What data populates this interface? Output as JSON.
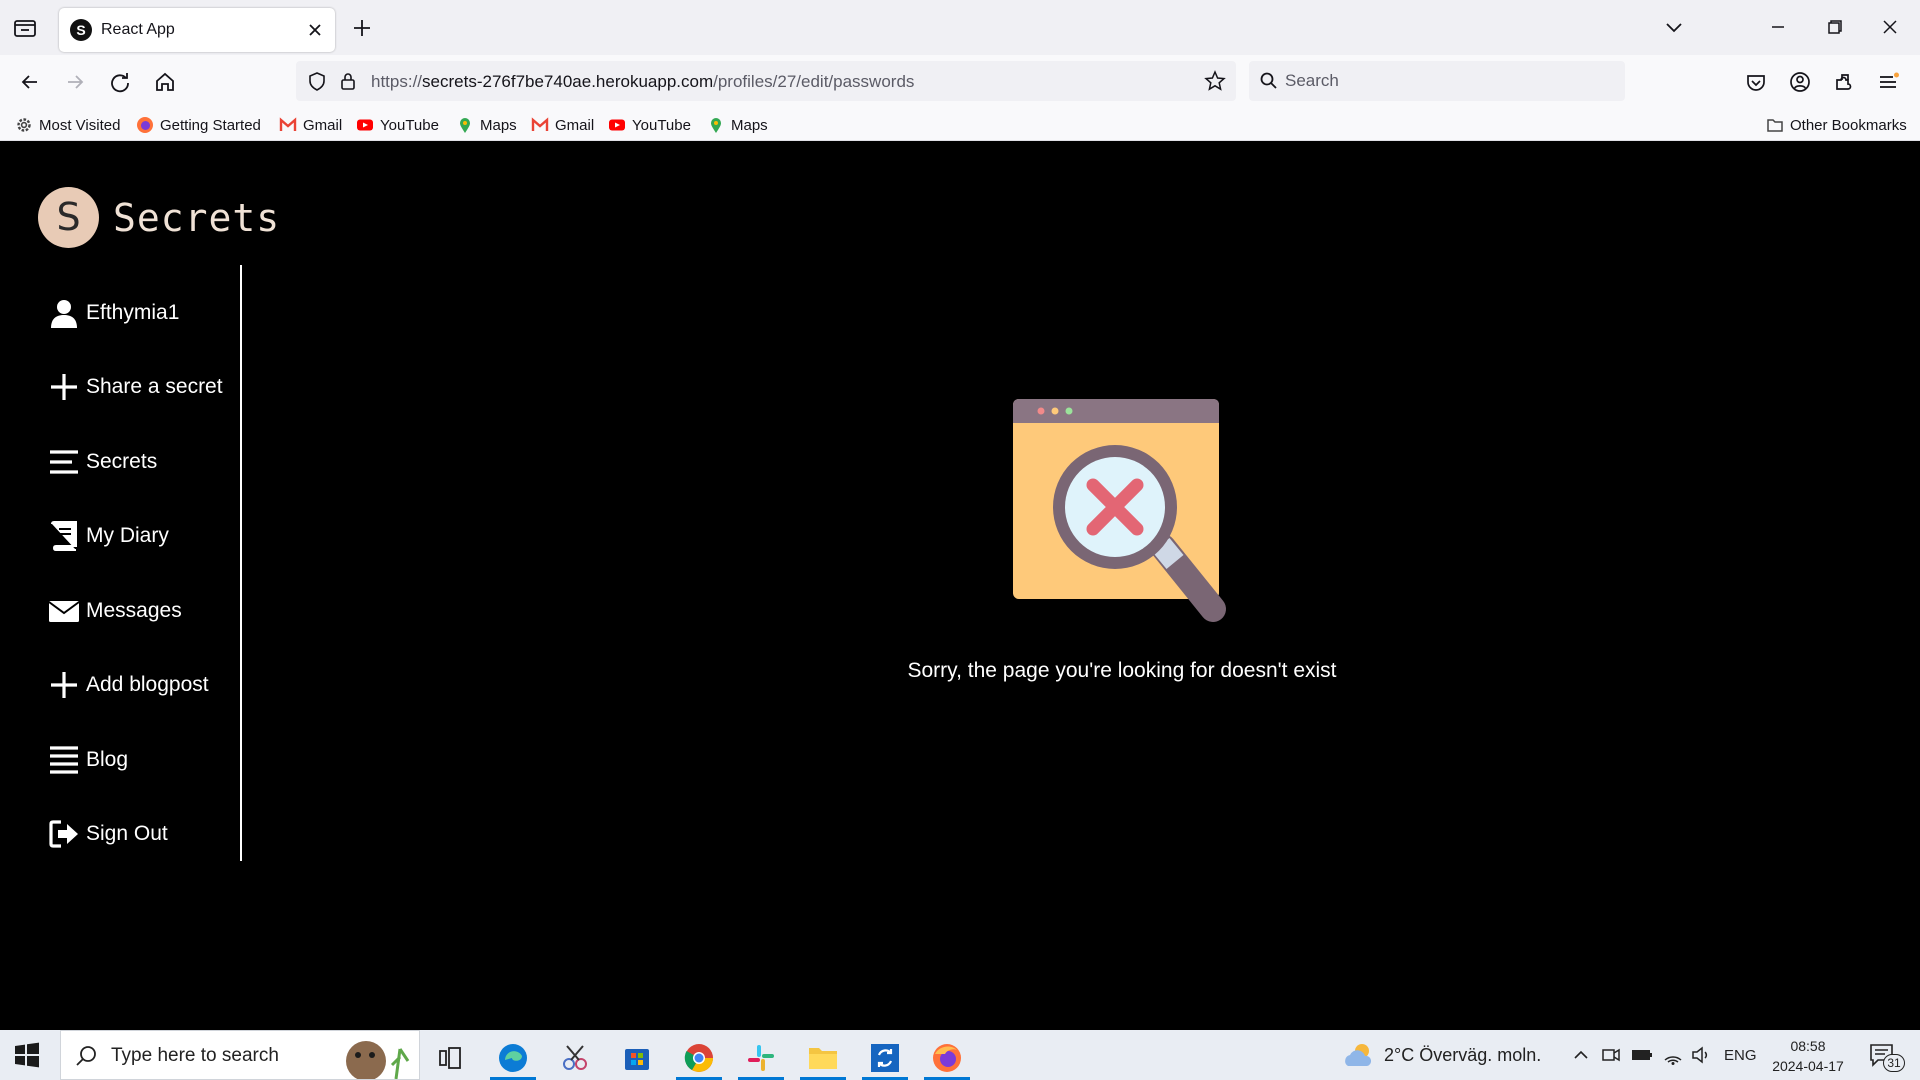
{
  "browser": {
    "tab": {
      "favicon_letter": "S",
      "title": "React App"
    },
    "url": {
      "scheme": "https://",
      "host": "secrets-276f7be740ae.herokuapp.com",
      "path": "/profiles/27/edit/passwords"
    },
    "search_placeholder": "Search",
    "bookmarks": [
      {
        "label": "Most Visited",
        "icon": "gear-icon"
      },
      {
        "label": "Getting Started",
        "icon": "firefox-icon"
      },
      {
        "label": "Gmail",
        "icon": "gmail-icon"
      },
      {
        "label": "YouTube",
        "icon": "youtube-icon"
      },
      {
        "label": "Maps",
        "icon": "maps-icon"
      },
      {
        "label": "Gmail",
        "icon": "gmail-icon"
      },
      {
        "label": "YouTube",
        "icon": "youtube-icon"
      },
      {
        "label": "Maps",
        "icon": "maps-icon"
      }
    ],
    "other_bookmarks": "Other Bookmarks"
  },
  "app": {
    "logo_letter": "S",
    "logo_name": "Secrets",
    "menu": [
      {
        "label": "Efthymia1",
        "icon": "user-icon"
      },
      {
        "label": "Share a secret",
        "icon": "plus-icon"
      },
      {
        "label": "Secrets",
        "icon": "lines-icon"
      },
      {
        "label": "My Diary",
        "icon": "book-icon"
      },
      {
        "label": "Messages",
        "icon": "envelope-icon"
      },
      {
        "label": "Add blogpost",
        "icon": "plus-icon"
      },
      {
        "label": "Blog",
        "icon": "list-icon"
      },
      {
        "label": "Sign Out",
        "icon": "sign-out-icon"
      }
    ],
    "not_found_message": "Sorry, the page you're looking for doesn't exist"
  },
  "taskbar": {
    "search_placeholder": "Type here to search",
    "weather": "2°C  Överväg. moln.",
    "language": "ENG",
    "time": "08:58",
    "date": "2024-04-17",
    "notifications": "31"
  },
  "colors": {
    "app_background": "#000000",
    "logo_circle": "#e8cbb6",
    "notfound_window": "#fec97a",
    "notfound_frame": "#8a7583",
    "error_x": "#e36674"
  }
}
